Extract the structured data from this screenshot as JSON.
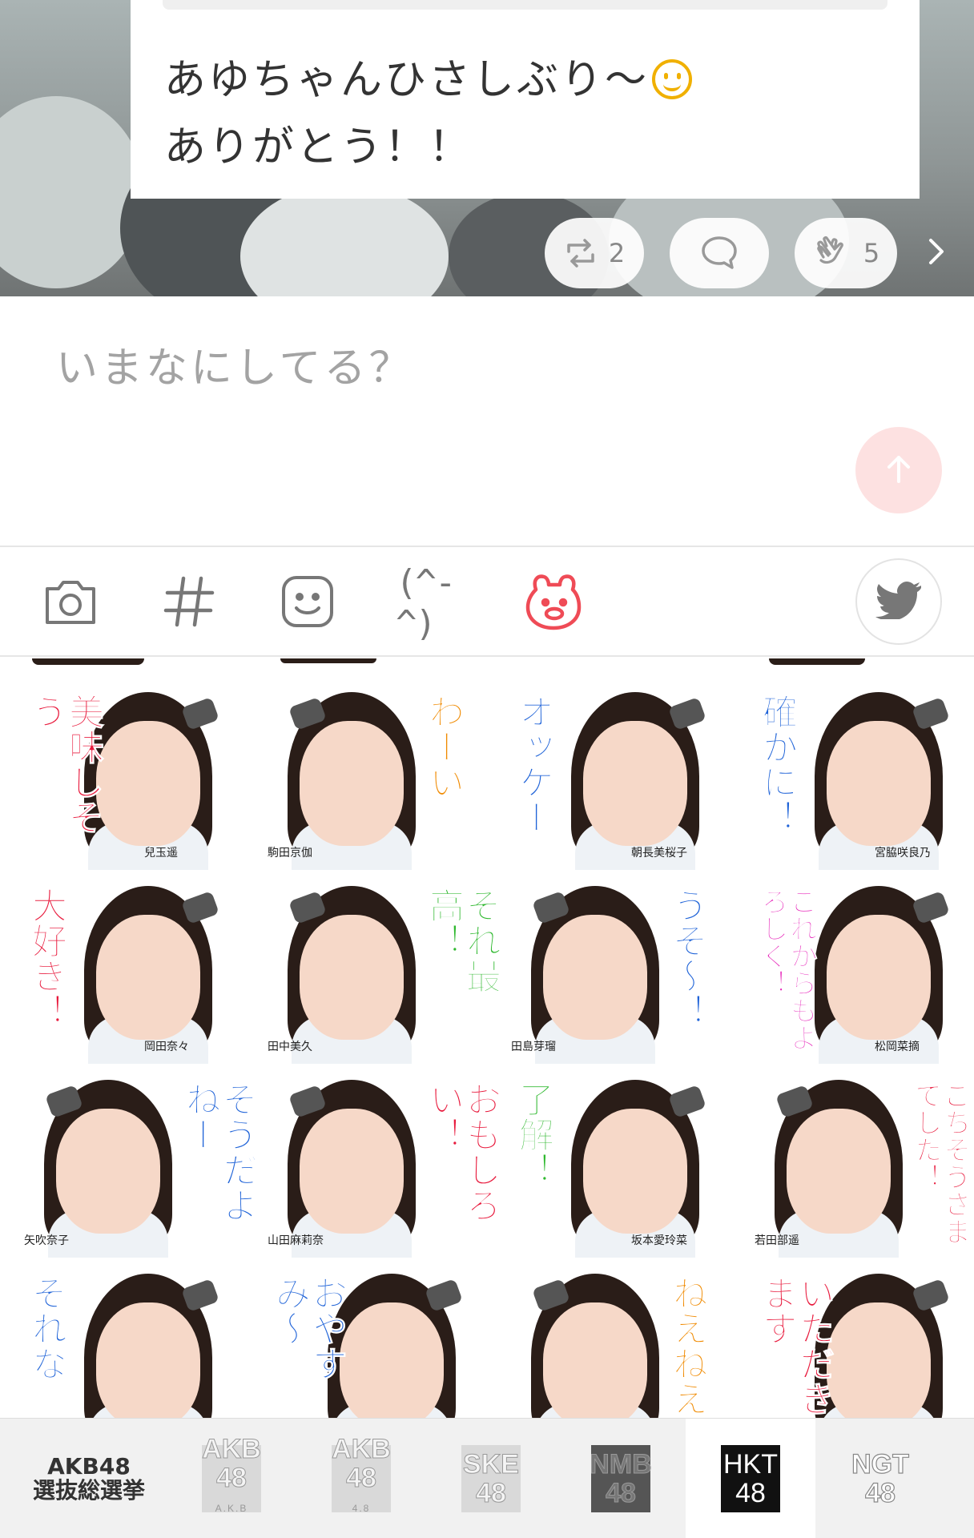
{
  "post": {
    "line1": "あゆちゃんひさしぶり〜",
    "line2": "ありがとう！！"
  },
  "actions": {
    "retweet_count": "2",
    "clap_count": "5"
  },
  "compose": {
    "placeholder": "いまなにしてる？"
  },
  "toolbar": {
    "kaomoji_label": "(^-^)"
  },
  "stickers": [
    {
      "text": "美味しそう",
      "color": "#e8193c",
      "name": "兒玉遥"
    },
    {
      "text": "わーい",
      "color": "#f08a00",
      "name": "駒田京伽"
    },
    {
      "text": "オッケー",
      "color": "#1f63d8",
      "name": "朝長美桜子"
    },
    {
      "text": "確かに！",
      "color": "#1f63d8",
      "name": "宮脇咲良乃"
    },
    {
      "text": "大好き！",
      "color": "#e8193c",
      "name": "岡田奈々"
    },
    {
      "text": "それ最高！",
      "color": "#2eb82e",
      "name": "田中美久"
    },
    {
      "text": "うそ〜！",
      "color": "#1f63d8",
      "name": "田島芽瑠"
    },
    {
      "text": "これからもよろしく！",
      "color": "#e620b8",
      "name": "松岡菜摘"
    },
    {
      "text": "そうだよねー",
      "color": "#1f63d8",
      "name": "矢吹奈子"
    },
    {
      "text": "おもしろい！",
      "color": "#e8193c",
      "name": "山田麻莉奈"
    },
    {
      "text": "了解！",
      "color": "#2eb82e",
      "name": "坂本愛玲菜"
    },
    {
      "text": "ごちそうさまでした！",
      "color": "#e8193c",
      "name": "若田部遥"
    },
    {
      "text": "それな",
      "color": "#1f63d8",
      "name": ""
    },
    {
      "text": "おやすみ〜",
      "color": "#1f63d8",
      "name": ""
    },
    {
      "text": "ねえねえ",
      "color": "#f08a00",
      "name": ""
    },
    {
      "text": "いただきます",
      "color": "#e8193c",
      "name": ""
    }
  ],
  "groups": [
    {
      "line1": "AKB48",
      "line2": "選抜総選挙",
      "sub": ""
    },
    {
      "line1": "AKB",
      "line2": "48",
      "sub": "A.K.B"
    },
    {
      "line1": "AKB",
      "line2": "48",
      "sub": "4.8"
    },
    {
      "line1": "SKE",
      "line2": "48",
      "sub": ""
    },
    {
      "line1": "NMB",
      "line2": "48",
      "sub": ""
    },
    {
      "line1": "HKT",
      "line2": "48",
      "sub": ""
    },
    {
      "line1": "NGT",
      "line2": "48",
      "sub": ""
    }
  ],
  "colors": {
    "accent_pink": "#ef4b56",
    "send_button_bg": "#fde1e1"
  },
  "icons": [
    "camera-icon",
    "hashtag-icon",
    "emoji-icon",
    "kaomoji-icon",
    "sticker-bear-icon",
    "twitter-icon",
    "retweet-icon",
    "comment-icon",
    "clap-icon",
    "chevron-right-icon",
    "send-arrow-icon"
  ]
}
